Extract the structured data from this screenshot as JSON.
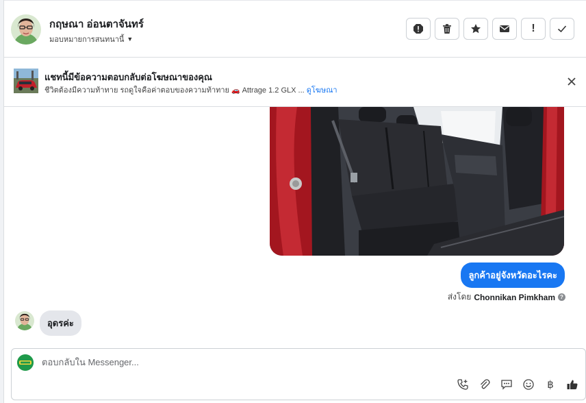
{
  "header": {
    "contact_name": "กฤษณา อ่อนตาจันทร์",
    "assign_label": "มอบหมายการสนทนานี้"
  },
  "toolbar": {
    "items": [
      "spam-icon",
      "trash-icon",
      "star-icon",
      "envelope-icon",
      "follow-up-icon",
      "check-icon"
    ],
    "follow_up_label": "!"
  },
  "ad": {
    "title": "แชทนี้มีข้อความตอบกลับต่อโฆษณาของคุณ",
    "subtitle": "ชีวิตต้องมีความท้าทาย รถดูใจคือค่าตอบของความท้าทาย",
    "car_emoji": "🚗",
    "model": "Attrage 1.2 GLX ...",
    "link_label": "ดูโฆษณา"
  },
  "thread": {
    "outgoing_message": "ลูกค้าอยู่จังหวัดอะไรคะ",
    "sent_by_prefix": "ส่งโดย",
    "sent_by_name": "Chonnikan Pimkham",
    "help_glyph": "?",
    "incoming_message": "อุดรค่ะ"
  },
  "composer": {
    "placeholder": "ตอบกลับใน Messenger...",
    "value": "",
    "baht_glyph": "฿",
    "icons": [
      "call-add-icon",
      "attachment-icon",
      "saved-reply-icon",
      "emoji-icon",
      "baht-icon",
      "like-icon"
    ]
  },
  "colors": {
    "accent": "#1877f2",
    "incoming_bubble": "#e4e6eb",
    "border": "#ccd0d5",
    "car_red": "#b01c24"
  }
}
